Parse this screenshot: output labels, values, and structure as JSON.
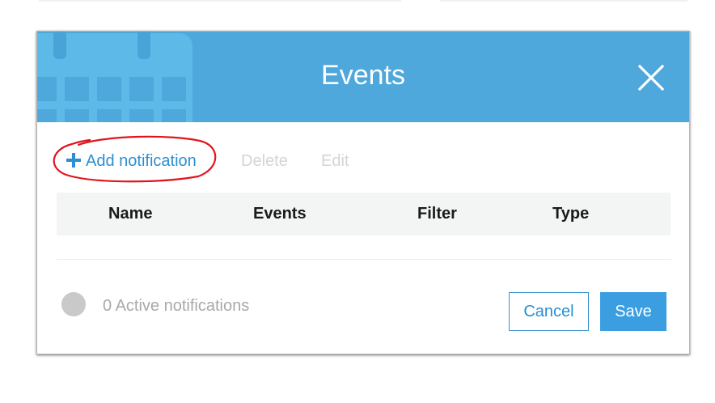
{
  "modal": {
    "title": "Events",
    "header_color": "#4fa8dc",
    "header_icon": "calendar-icon",
    "close_icon": "close-icon"
  },
  "toolbar": {
    "add_label": "Add notification",
    "add_icon": "plus-icon",
    "delete_label": "Delete",
    "edit_label": "Edit"
  },
  "table": {
    "columns": [
      "Name",
      "Events",
      "Filter",
      "Type"
    ]
  },
  "footer": {
    "status_text": "0 Active notifications",
    "cancel_label": "Cancel",
    "save_label": "Save"
  },
  "colors": {
    "accent": "#3a9ee0",
    "link": "#2b8fd1",
    "disabled_text": "#d4d4d4",
    "annotation": "#e0141c"
  }
}
